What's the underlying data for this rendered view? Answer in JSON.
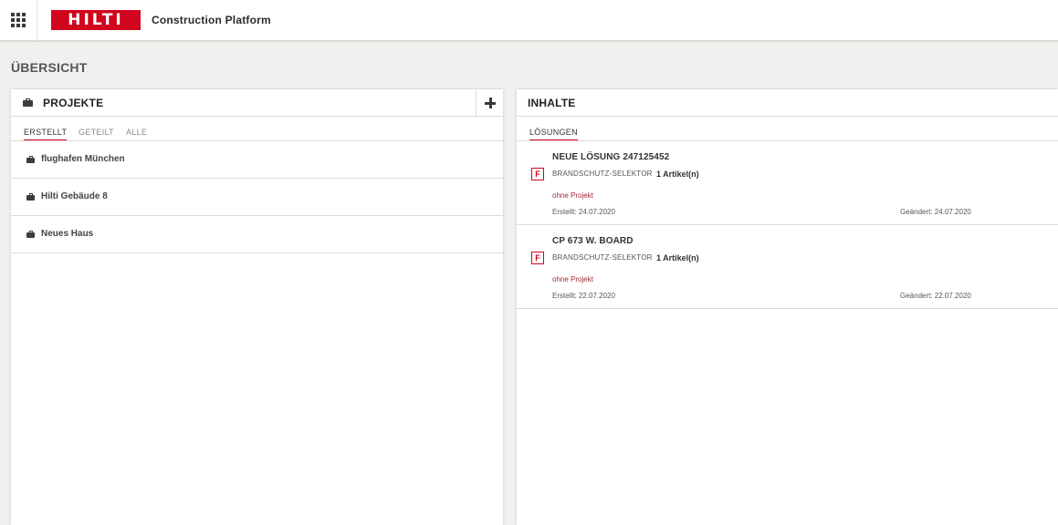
{
  "header": {
    "logo_text": "HILTI",
    "app_title": "Construction Platform",
    "brand_color": "#d2051e"
  },
  "page": {
    "title": "ÜBERSICHT"
  },
  "projects_panel": {
    "title": "PROJEKTE",
    "icon": "briefcase-icon",
    "add_icon": "plus-icon",
    "tabs": [
      {
        "label": "ERSTELLT",
        "active": true
      },
      {
        "label": "GETEILT",
        "active": false
      },
      {
        "label": "ALLE",
        "active": false
      }
    ],
    "projects": [
      {
        "name": "flughafen München"
      },
      {
        "name": "Hilti Gebäude 8"
      },
      {
        "name": "Neues Haus"
      }
    ]
  },
  "contents_panel": {
    "title": "INHALTE",
    "tabs": [
      {
        "label": "LÖSUNGEN",
        "active": true
      }
    ],
    "solutions": [
      {
        "title": "NEUE LÖSUNG 247125452",
        "badge": "F",
        "type": "BRANDSCHUTZ-SELEKTOR",
        "count": "1 Artikel(n)",
        "project": "ohne Projekt",
        "created": "Erstellt: 24.07.2020",
        "changed": "Geändert: 24.07.2020"
      },
      {
        "title": "CP 673 W. BOARD",
        "badge": "F",
        "type": "BRANDSCHUTZ-SELEKTOR",
        "count": "1 Artikel(n)",
        "project": "ohne Projekt",
        "created": "Erstellt: 22.07.2020",
        "changed": "Geändert: 22.07.2020"
      }
    ]
  }
}
